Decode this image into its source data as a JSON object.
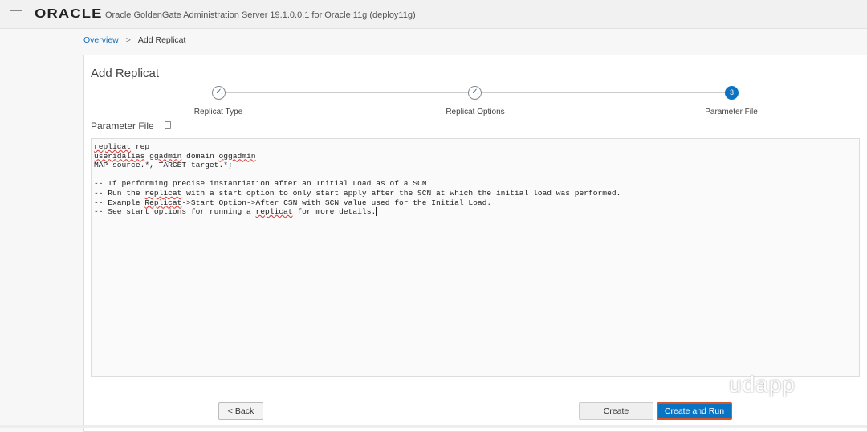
{
  "header": {
    "logo": "ORACLE",
    "title": "Oracle GoldenGate Administration Server 19.1.0.0.1 for Oracle 11g (deploy11g)"
  },
  "breadcrumb": {
    "link": "Overview",
    "separator": ">",
    "current": "Add Replicat"
  },
  "page_title": "Add Replicat",
  "steps": [
    {
      "label": "Replicat Type",
      "mark": "✓"
    },
    {
      "label": "Replicat Options",
      "mark": "✓"
    },
    {
      "label": "Parameter File",
      "number": "3"
    }
  ],
  "section_label": "Parameter File",
  "editor": {
    "lines": [
      [
        {
          "t": "replicat",
          "s": 1
        },
        {
          "t": " rep"
        }
      ],
      [
        {
          "t": "useridalias",
          "s": 1
        },
        {
          "t": " "
        },
        {
          "t": "ggadmin",
          "s": 1
        },
        {
          "t": " domain "
        },
        {
          "t": "oggadmin",
          "s": 1
        }
      ],
      [
        {
          "t": "MAP source.*, TARGET target.*;"
        }
      ],
      [
        {
          "t": ""
        }
      ],
      [
        {
          "t": "-- If performing precise instantiation after an Initial Load as of a SCN"
        }
      ],
      [
        {
          "t": "-- Run the "
        },
        {
          "t": "replicat",
          "s": 1
        },
        {
          "t": " with a start option to only start apply after the SCN at which the initial load was performed."
        }
      ],
      [
        {
          "t": "-- Example "
        },
        {
          "t": "Replicat",
          "s": 1
        },
        {
          "t": "->Start Option->After CSN with SCN value used for the Initial Load."
        }
      ],
      [
        {
          "t": "-- See start options for running a "
        },
        {
          "t": "replicat",
          "s": 1
        },
        {
          "t": " for more details."
        }
      ]
    ]
  },
  "buttons": {
    "back": "< Back",
    "create": "Create",
    "create_and_run": "Create and Run"
  },
  "watermark": "udapp",
  "colors": {
    "accent": "#0a74c2",
    "focus": "#d9542b"
  }
}
